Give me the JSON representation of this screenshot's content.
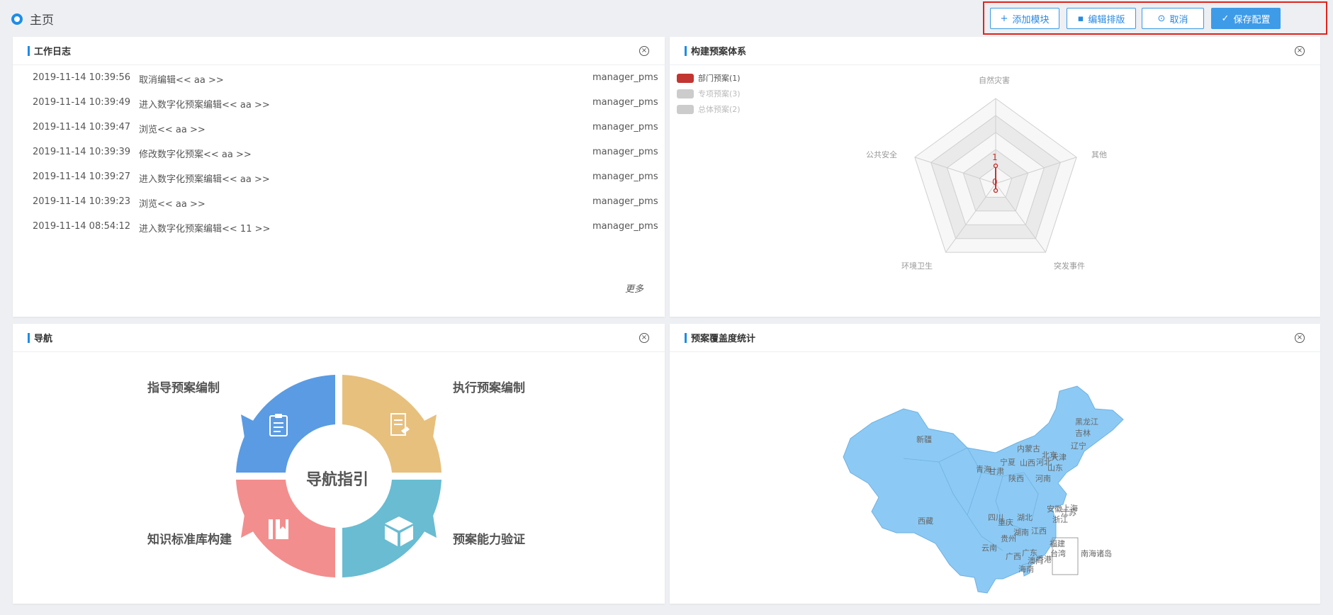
{
  "header": {
    "home_label": "主页"
  },
  "toolbar": {
    "add_module": "添加模块",
    "edit_layout": "编辑排版",
    "cancel": "取消",
    "save_config": "保存配置"
  },
  "worklog": {
    "title": "工作日志",
    "rows": [
      {
        "time": "2019-11-14 10:39:56",
        "action": "取消编辑<< aa >>",
        "user": "manager_pms"
      },
      {
        "time": "2019-11-14 10:39:49",
        "action": "进入数字化预案编辑<< aa >>",
        "user": "manager_pms"
      },
      {
        "time": "2019-11-14 10:39:47",
        "action": "浏览<< aa >>",
        "user": "manager_pms"
      },
      {
        "time": "2019-11-14 10:39:39",
        "action": "修改数字化预案<< aa >>",
        "user": "manager_pms"
      },
      {
        "time": "2019-11-14 10:39:27",
        "action": "进入数字化预案编辑<< aa >>",
        "user": "manager_pms"
      },
      {
        "time": "2019-11-14 10:39:23",
        "action": "浏览<< aa >>",
        "user": "manager_pms"
      },
      {
        "time": "2019-11-14 08:54:12",
        "action": "进入数字化预案编辑<< 11 >>",
        "user": "manager_pms"
      }
    ],
    "more": "更多"
  },
  "radar": {
    "title": "构建预案体系",
    "legend": [
      {
        "label": "部门预案(1)",
        "color": "#c23531",
        "active": true
      },
      {
        "label": "专项预案(3)",
        "color": "#cccccc",
        "active": false
      },
      {
        "label": "总体预案(2)",
        "color": "#cccccc",
        "active": false
      }
    ],
    "indicators": [
      "自然灾害",
      "其他",
      "突发事件",
      "环境卫生",
      "公共安全"
    ],
    "tick_labels": [
      "1",
      "0"
    ]
  },
  "navigation": {
    "title": "导航",
    "center": "导航指引",
    "items": [
      "指导预案编制",
      "执行预案编制",
      "知识标准库构建",
      "预案能力验证"
    ],
    "colors": [
      "#5a9be3",
      "#e7c07e",
      "#f38e8e",
      "#69bcd2"
    ]
  },
  "coverage": {
    "title": "预案覆盖度统计",
    "map_color": "#8ccaf5",
    "provinces": [
      "黑龙江",
      "吉林",
      "辽宁",
      "内蒙古",
      "北京",
      "天津",
      "河北",
      "山西",
      "山东",
      "宁夏",
      "青海",
      "甘肃",
      "陕西",
      "河南",
      "新疆",
      "西藏",
      "四川",
      "重庆",
      "湖北",
      "安徽",
      "江苏",
      "浙江",
      "上海",
      "江西",
      "湖南",
      "贵州",
      "云南",
      "广西",
      "广东",
      "福建",
      "台湾",
      "香港",
      "澳门",
      "海南",
      "南海诸岛"
    ]
  }
}
